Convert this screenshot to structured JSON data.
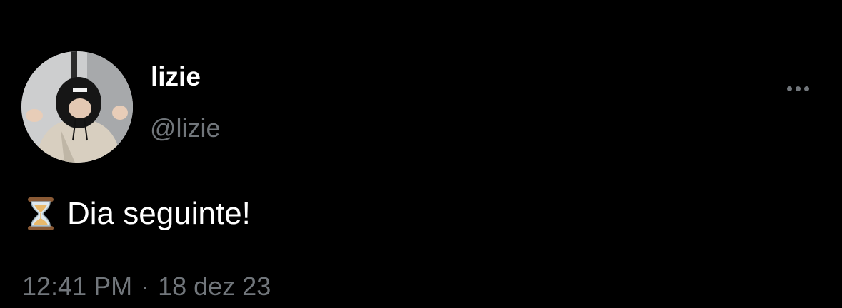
{
  "author": {
    "display_name": "lizie",
    "handle": "@lizie",
    "avatar_icon": "profile-photo"
  },
  "tweet": {
    "emoji_icon": "hourglass-icon",
    "text": "Dia seguinte!"
  },
  "meta": {
    "time": "12:41 PM",
    "separator": "·",
    "date": "18 dez 23"
  },
  "menu": {
    "icon": "more-dots-icon"
  },
  "colors": {
    "background": "#000000",
    "primary_text": "#ffffff",
    "secondary_text": "#71767b"
  }
}
